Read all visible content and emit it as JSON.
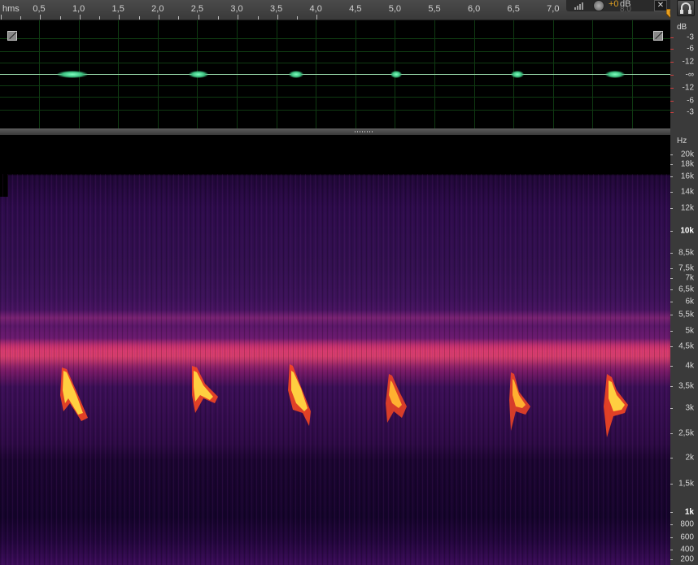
{
  "ruler": {
    "unit": "hms",
    "labels": [
      "0,5",
      "1,0",
      "1,5",
      "2,0",
      "2,5",
      "3,0",
      "3,5",
      "4,0",
      "4,5",
      "5,0",
      "5,5",
      "6,0",
      "6,5",
      "7,0"
    ]
  },
  "toolbar": {
    "gain_value": "+0",
    "gain_unit": "dB",
    "gain_sub": "8.0"
  },
  "amplitude_scale": {
    "unit": "dB",
    "labels": [
      "-3",
      "-6",
      "-12",
      "-∞",
      "-12",
      "-6",
      "-3"
    ]
  },
  "frequency_scale": {
    "unit": "Hz",
    "labels": [
      "20k",
      "18k",
      "16k",
      "14k",
      "12k",
      "10k",
      "8,5k",
      "7,5k",
      "7k",
      "6,5k",
      "6k",
      "5,5k",
      "5k",
      "4,5k",
      "4k",
      "3,5k",
      "3k",
      "2,5k",
      "2k",
      "1,5k",
      "1k",
      "800",
      "600",
      "400",
      "200"
    ]
  },
  "colors": {
    "waveform": "#7fffc0",
    "call_hot": "#ffd040",
    "call_warm": "#ff5020",
    "band": "#c53a6a"
  }
}
